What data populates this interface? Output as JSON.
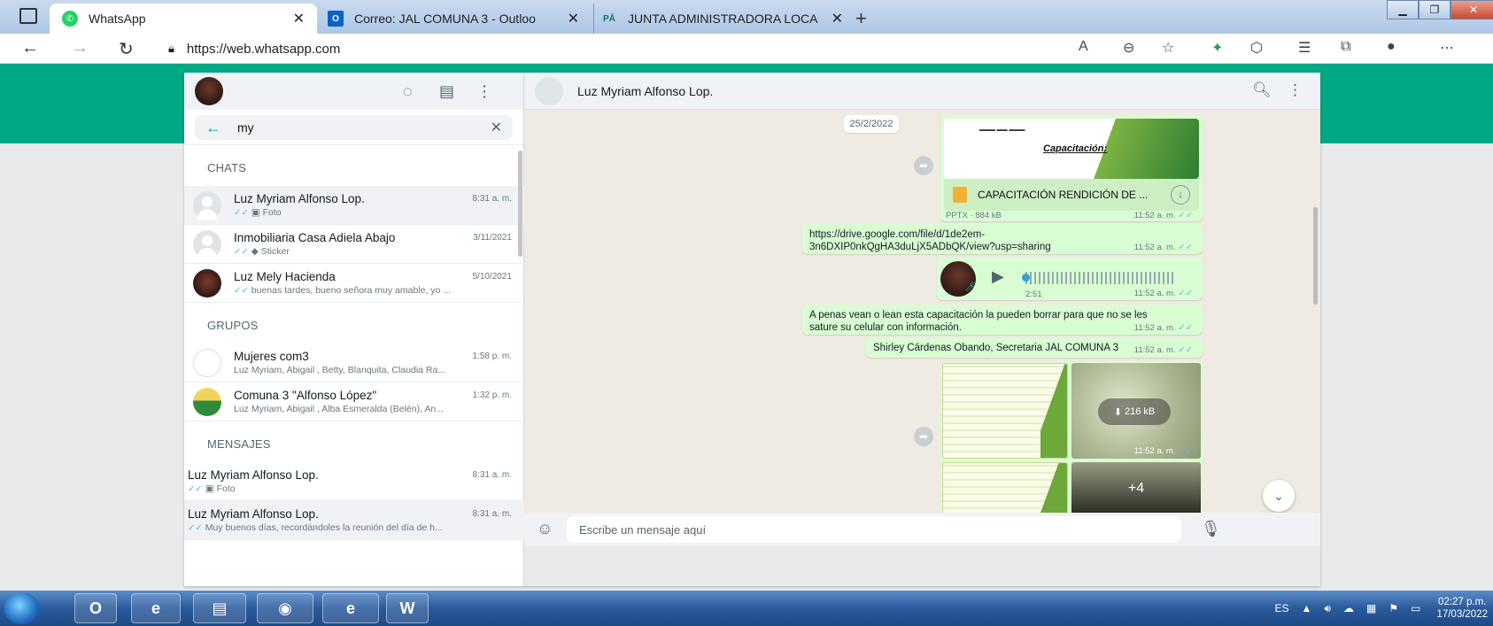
{
  "browser": {
    "tabs": [
      {
        "title": "WhatsApp",
        "favicon": "whatsapp-icon",
        "active": true
      },
      {
        "title": "Correo: JAL COMUNA 3 - Outloo",
        "favicon": "outlook-icon",
        "active": false
      },
      {
        "title": "JUNTA ADMINISTRADORA LOCA",
        "favicon": "publisher-icon",
        "active": false
      }
    ],
    "url": "https://web.whatsapp.com",
    "colors": {
      "chrome": "#c9daf0",
      "whatsapp_green": "#00a884"
    }
  },
  "search": {
    "value": "my"
  },
  "sidebar": {
    "sections": {
      "chats": "CHATS",
      "groups": "GRUPOS",
      "messages": "MENSAJES"
    },
    "chats": [
      {
        "name": "Luz Myriam Alfonso Lop.",
        "time": "8:31 a. m.",
        "preview": "Foto",
        "preview_icon": "camera-icon",
        "selected": true
      },
      {
        "name": "Inmobiliaria Casa Adiela Abajo",
        "time": "3/11/2021",
        "preview": "Sticker",
        "preview_icon": "sticker-icon"
      },
      {
        "name": "Luz Mely Hacienda",
        "time": "5/10/2021",
        "preview": "buenas tardes, bueno señora muy amable, yo ..."
      }
    ],
    "groups": [
      {
        "name": "Mujeres com3",
        "time": "1:58 p. m.",
        "preview": "Luz Myriam, Abigail , Betty, Blanquita, Claudia Ra..."
      },
      {
        "name": "Comuna 3 \"Alfonso López\"",
        "time": "1:32 p. m.",
        "preview": "Luz Myriam, Abigail , Alba Esmeralda (Belén), An..."
      }
    ],
    "messages": [
      {
        "name": "Luz Myriam Alfonso Lop.",
        "time": "8:31 a. m.",
        "preview": "Foto",
        "preview_icon": "camera-icon"
      },
      {
        "name": "Luz Myriam Alfonso Lop.",
        "time": "8:31 a. m.",
        "preview": "Muy buenos días, recordándoles la reunión del día de h..."
      }
    ]
  },
  "chat": {
    "contact": "Luz Myriam Alfonso Lop.",
    "date": "25/2/2022",
    "doc": {
      "preview_title": "Capacitación:",
      "filename": "CAPACITACIÓN RENDICIÓN DE ...",
      "meta": "PPTX · 884 kB",
      "time": "11:52 a. m."
    },
    "link": {
      "text_line1": "https://drive.google.com/file/d/1de2em-",
      "text_line2": "3n6DXIP0nkQgHA3duLjX5ADbQK/view?usp=sharing",
      "time": "11:52 a. m."
    },
    "voice": {
      "duration": "2:51",
      "time": "11:52 a. m."
    },
    "text1": {
      "line1": "A penas vean o lean esta capacitación la pueden borrar para que no se les",
      "line2": "sature su celular con información.",
      "time": "11:52 a. m."
    },
    "text2": {
      "text": "Shirley Cárdenas Obando, Secretaria JAL COMUNA 3",
      "time": "11:52 a. m."
    },
    "album": {
      "download_size": "216 kB",
      "time": "11:52 a. m.",
      "more": "+4"
    },
    "composer_placeholder": "Escribe un mensaje aquí"
  },
  "taskbar": {
    "lang": "ES",
    "time": "02:27 p.m.",
    "date": "17/03/2022"
  }
}
